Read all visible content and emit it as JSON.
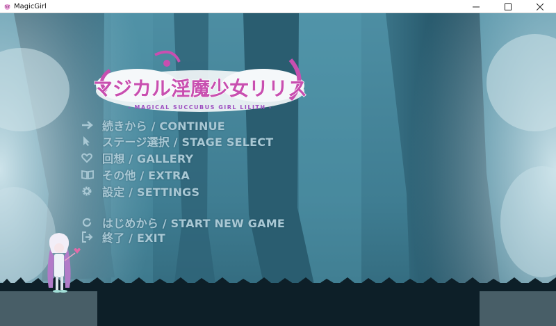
{
  "window": {
    "title": "MagicGirl",
    "controls": {
      "minimize": "minimize-icon",
      "maximize": "maximize-icon",
      "close": "close-icon"
    }
  },
  "logo": {
    "title": "マジカル淫魔少女リリス",
    "subtitle": "- MAGICAL SUCCUBUS GIRL LILITH -"
  },
  "menu": {
    "items": [
      {
        "icon": "arrow-right-icon",
        "label": "続きから / CONTINUE"
      },
      {
        "icon": "pointer-icon",
        "label": "ステージ選択 / STAGE SELECT"
      },
      {
        "icon": "heart-icon",
        "label": "回想 / GALLERY"
      },
      {
        "icon": "book-icon",
        "label": "その他 / EXTRA"
      },
      {
        "icon": "gear-icon",
        "label": "設定 / SETTINGS"
      }
    ],
    "new_game": {
      "icon": "restart-icon",
      "label": "はじめから / START NEW GAME"
    },
    "exit": {
      "icon": "exit-icon",
      "label": "終了 / EXIT"
    }
  },
  "colors": {
    "background": "#3f7a90",
    "menu_text": "#a9c8d4",
    "logo_pink": "#c84fb0",
    "fog": "#c9e0e8"
  }
}
